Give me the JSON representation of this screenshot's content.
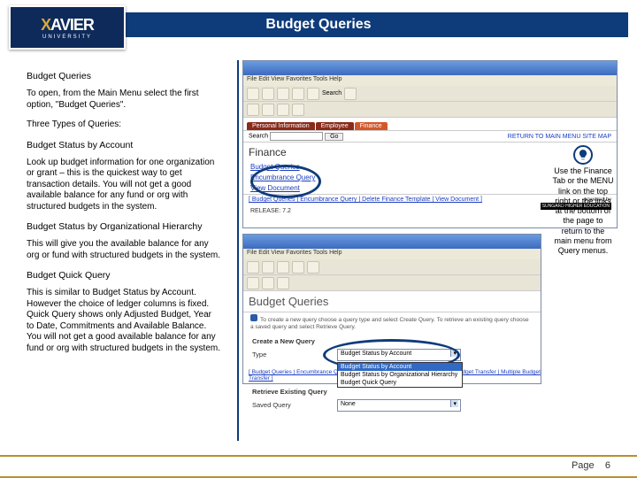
{
  "logo": {
    "main": "XAVIER",
    "sub": "UNIVERSITY"
  },
  "header": {
    "title": "Budget Queries"
  },
  "left": {
    "h1": "Budget Queries",
    "p1": "To open, from the Main Menu select the first option, \"Budget Queries\".",
    "p2": "Three Types of Queries:",
    "h2": "Budget Status by Account",
    "p3": "Look up budget information for one organization or grant – this is the quickest way to get transaction details. You will not get a good available balance for any fund or org with structured budgets in the system.",
    "h3": "Budget Status by Organizational Hierarchy",
    "p4": "This will give you the available balance for any org or fund with structured budgets in the system.",
    "h4": "Budget Quick Query",
    "p5": "This is similar to Budget Status by Account. However the choice of ledger columns is fixed. Quick Query shows only Adjusted Budget, Year to Date, Commitments and Available Balance. You will not get a good available balance for any fund or org with structured budgets in the system."
  },
  "tip": {
    "text": "Use the Finance Tab or the MENU link on the top right or the links at the bottom of the page to return to the main menu from Query menus."
  },
  "mock1": {
    "menu": "File  Edit  View  Favorites  Tools  Help",
    "search_toolbar": "Search",
    "tabs": [
      "Personal Information",
      "Employee",
      "Finance"
    ],
    "search_label": "Search",
    "go": "Go",
    "right_links": "RETURN TO MAIN MENU   SITE MAP",
    "heading": "Finance",
    "links": [
      "Budget Queries",
      "Encumbrance Query",
      "View Document"
    ],
    "topline": "[ Budget Queries | Encumbrance Query | Delete Finance Template | View Document ]",
    "release": "RELEASE: 7.2",
    "powered": "powered by",
    "powered2": "SUNGARD HIGHER EDUCATION"
  },
  "mock2": {
    "menu": "File  Edit  View  Favorites  Tools  Help",
    "heading": "Budget Queries",
    "sub": "To create a new query choose a query type and select Create Query. To retrieve an existing query choose a saved query and select Retrieve Query.",
    "row1_label": "Create a New Query",
    "row1_sub": "Type",
    "dd_selected": "Budget Status by Account",
    "dd_items": [
      "Budget Status by Account",
      "Budget Status by Organizational Hierarchy",
      "Budget Quick Query"
    ],
    "row2_label": "Retrieve Existing Query",
    "row2_sub": "Saved Query",
    "row2_val": "None",
    "bot_links": "[ Budget Queries | Encumbrance Query | Approve Documents | View Document | Budget Transfer | Multiple Budget Transfer ]"
  },
  "footer": {
    "page_label": "Page",
    "page_num": "6"
  }
}
